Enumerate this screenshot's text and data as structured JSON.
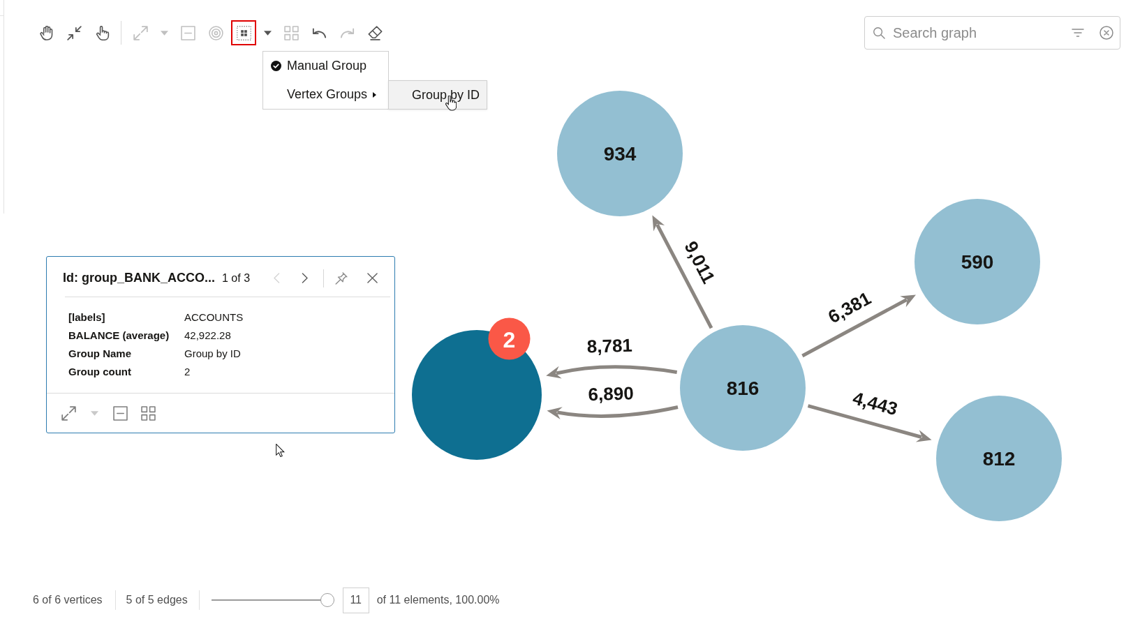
{
  "toolbar": {
    "groups": [
      [
        {
          "kind": "pan",
          "disabled": false,
          "highlighted": false
        },
        {
          "kind": "fit",
          "disabled": false,
          "highlighted": false
        },
        {
          "kind": "select",
          "disabled": false,
          "highlighted": false
        }
      ],
      [
        {
          "kind": "expand",
          "disabled": true,
          "highlighted": false
        },
        {
          "kind": "dropdown",
          "disabled": true,
          "highlighted": false
        },
        {
          "kind": "drop",
          "disabled": true,
          "highlighted": false
        },
        {
          "kind": "focus",
          "disabled": true,
          "highlighted": false
        },
        {
          "kind": "group",
          "disabled": false,
          "highlighted": true
        },
        {
          "kind": "dropdown",
          "disabled": false,
          "highlighted": false
        },
        {
          "kind": "ungroup",
          "disabled": true,
          "highlighted": false
        },
        {
          "kind": "undo",
          "disabled": false,
          "highlighted": false
        },
        {
          "kind": "redo",
          "disabled": true,
          "highlighted": false
        },
        {
          "kind": "clear",
          "disabled": false,
          "highlighted": false
        }
      ]
    ]
  },
  "search": {
    "placeholder": "Search graph"
  },
  "group_menu": {
    "items": [
      {
        "label": "Manual Group",
        "checked": true
      },
      {
        "label": "Vertex Groups",
        "checked": false,
        "children": [
          {
            "label": "Group by ID",
            "hovered": true
          }
        ]
      }
    ]
  },
  "graph": {
    "nodes": [
      {
        "kind": "vertex",
        "label": "934"
      },
      {
        "kind": "vertex",
        "label": "590"
      },
      {
        "kind": "group",
        "badge": "2"
      },
      {
        "kind": "vertex",
        "label": "816"
      },
      {
        "kind": "vertex",
        "label": "812"
      }
    ],
    "edges": [
      {
        "label": "9,011"
      },
      {
        "label": "6,381"
      },
      {
        "label": "8,781"
      },
      {
        "label": "6,890"
      },
      {
        "label": "4,443"
      }
    ]
  },
  "info_panel": {
    "title": "Id: group_BANK_ACCO...",
    "pager": "1 of 3",
    "header_buttons": [
      {
        "kind": "previous",
        "disabled": true
      },
      {
        "kind": "next",
        "disabled": false
      },
      {
        "kind": "pin",
        "disabled": false
      },
      {
        "kind": "close",
        "disabled": false
      }
    ],
    "properties": [
      {
        "key": "[labels]",
        "value": "ACCOUNTS"
      },
      {
        "key": "BALANCE (average)",
        "value": "42,922.28"
      },
      {
        "key": "Group Name",
        "value": "Group by ID"
      },
      {
        "key": "Group count",
        "value": "2"
      }
    ],
    "footer_buttons": [
      {
        "kind": "expand",
        "disabled": false
      },
      {
        "kind": "dropdown",
        "disabled": true
      },
      {
        "kind": "drop",
        "disabled": false
      },
      {
        "kind": "ungroup",
        "disabled": false
      }
    ]
  },
  "status_bar": {
    "vertices": "6 of 6 vertices",
    "edges": "5 of 5 edges",
    "slider": {
      "level": 1
    },
    "count_field": {
      "value": "11"
    },
    "summary": "of 11 elements, 100.00%"
  }
}
